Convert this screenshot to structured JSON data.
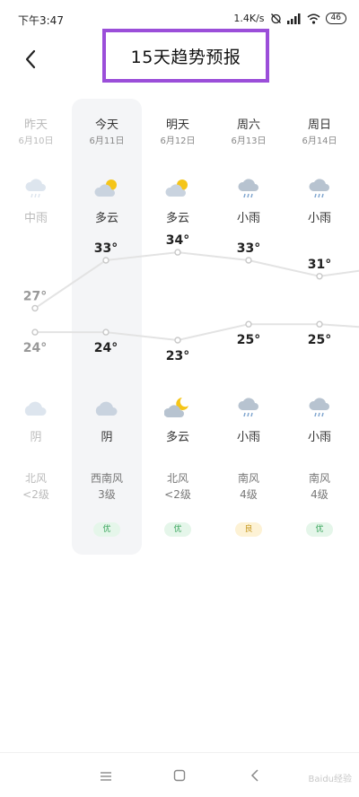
{
  "status_bar": {
    "time": "下午3:47",
    "net_speed": "1.4K/s",
    "battery": "46"
  },
  "header": {
    "title": "15天趋势预报"
  },
  "days": [
    {
      "name": "昨天",
      "date": "6月10日",
      "day_weather": "中雨",
      "day_icon": "rain-cloud-icon",
      "night_weather": "阴",
      "night_icon": "cloud-icon",
      "high": "27°",
      "low": "24°",
      "wind_dir": "北风",
      "wind_level": "<2级",
      "aqi": ""
    },
    {
      "name": "今天",
      "date": "6月11日",
      "day_weather": "多云",
      "day_icon": "partly-cloudy-icon",
      "night_weather": "阴",
      "night_icon": "cloud-icon",
      "high": "33°",
      "low": "24°",
      "wind_dir": "西南风",
      "wind_level": "3级",
      "aqi": "优"
    },
    {
      "name": "明天",
      "date": "6月12日",
      "day_weather": "多云",
      "day_icon": "partly-cloudy-icon",
      "night_weather": "多云",
      "night_icon": "partly-cloudy-night-icon",
      "high": "34°",
      "low": "23°",
      "wind_dir": "北风",
      "wind_level": "<2级",
      "aqi": "优"
    },
    {
      "name": "周六",
      "date": "6月13日",
      "day_weather": "小雨",
      "day_icon": "rain-cloud-icon",
      "night_weather": "小雨",
      "night_icon": "rain-cloud-icon",
      "high": "33°",
      "low": "25°",
      "wind_dir": "南风",
      "wind_level": "4级",
      "aqi": "良"
    },
    {
      "name": "周日",
      "date": "6月14日",
      "day_weather": "小雨",
      "day_icon": "rain-cloud-icon",
      "night_weather": "小雨",
      "night_icon": "rain-cloud-icon",
      "high": "31°",
      "low": "25°",
      "wind_dir": "南风",
      "wind_level": "4级",
      "aqi": "优"
    }
  ],
  "chart_data": {
    "type": "line",
    "categories": [
      "昨天",
      "今天",
      "明天",
      "周六",
      "周日"
    ],
    "series": [
      {
        "values": [
          27,
          33,
          34,
          33,
          31
        ]
      },
      {
        "values": [
          24,
          24,
          23,
          25,
          25
        ]
      }
    ]
  },
  "colors": {
    "title_highlight": "#9b4ed9",
    "sun": "#f5c518",
    "cloud": "#c9d3df",
    "aqi_good": "#3aa55c",
    "aqi_ok": "#c79a22"
  },
  "watermark": "Baidu经验"
}
